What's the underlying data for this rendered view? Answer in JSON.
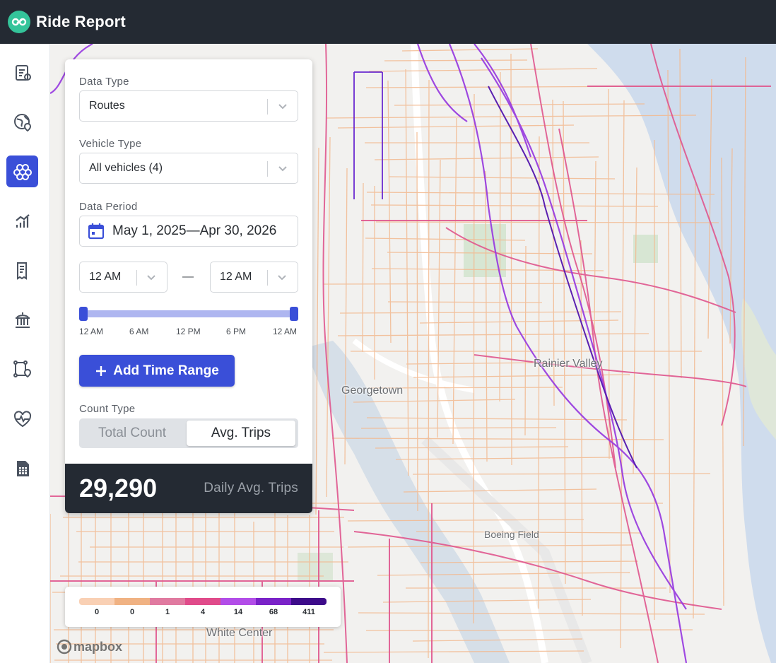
{
  "app": {
    "title": "Ride Report"
  },
  "sidebar": {
    "items": [
      {
        "icon": "report-icon",
        "active": false
      },
      {
        "icon": "globe-pin-icon",
        "active": false
      },
      {
        "icon": "hexagon-cluster-icon",
        "active": true
      },
      {
        "icon": "bar-chart-icon",
        "active": false
      },
      {
        "icon": "document-icon",
        "active": false
      },
      {
        "icon": "government-building-icon",
        "active": false
      },
      {
        "icon": "route-pin-icon",
        "active": false
      },
      {
        "icon": "heartbeat-icon",
        "active": false
      },
      {
        "icon": "spreadsheet-icon",
        "active": false
      }
    ]
  },
  "panel": {
    "data_type": {
      "label": "Data Type",
      "value": "Routes"
    },
    "vehicle_type": {
      "label": "Vehicle Type",
      "value": "All vehicles (4)"
    },
    "data_period": {
      "label": "Data Period",
      "value": "May 1, 2025—Apr 30, 2026"
    },
    "time_from": "12 AM",
    "time_separator": "—",
    "time_to": "12 AM",
    "slider": {
      "ticks": [
        "12 AM",
        "6 AM",
        "12 PM",
        "6 PM",
        "12 AM"
      ],
      "range": [
        0,
        1
      ]
    },
    "add_time_range": "Add Time Range",
    "count_type": {
      "label": "Count Type",
      "options": [
        "Total Count",
        "Avg. Trips"
      ],
      "selected": "Avg. Trips"
    },
    "summary": {
      "value": "29,290",
      "label": "Daily Avg. Trips"
    }
  },
  "map": {
    "labels": [
      "Georgetown",
      "Rainier Valley",
      "Boeing Field",
      "White Center"
    ],
    "attribution": "mapbox"
  },
  "legend": {
    "colors": [
      "#f9d0b4",
      "#f0b283",
      "#e07aa0",
      "#e04b8a",
      "#b24de8",
      "#7a22c8",
      "#3d0b8a"
    ],
    "values": [
      "0",
      "0",
      "1",
      "4",
      "14",
      "68",
      "411"
    ]
  }
}
